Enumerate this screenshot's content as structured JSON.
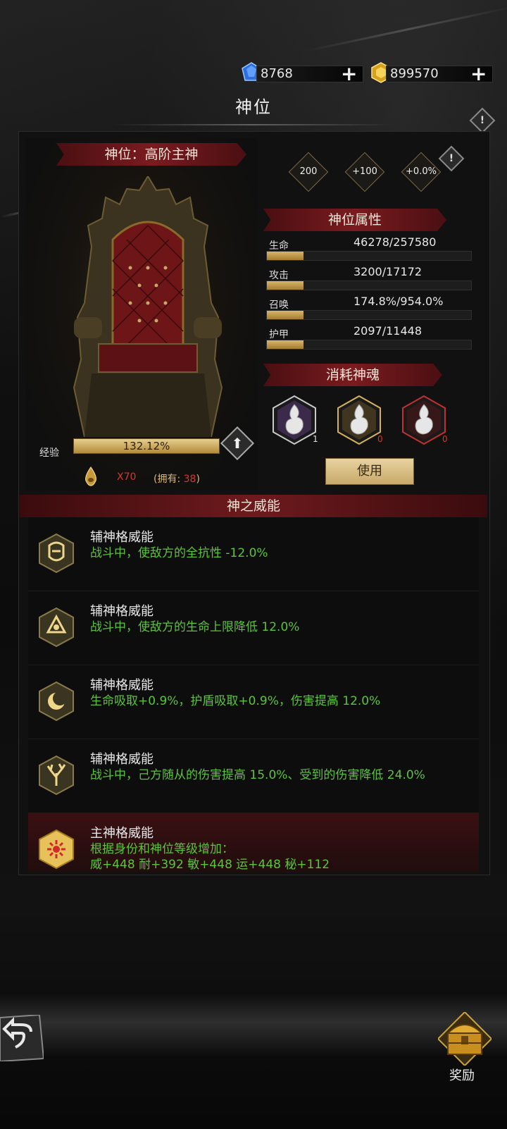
{
  "currency": {
    "gems": {
      "value": "8768",
      "icon": "blue-gem-icon",
      "add": "+"
    },
    "gold": {
      "value": "899570",
      "icon": "gold-gem-icon",
      "add": "+"
    }
  },
  "title": "神位",
  "info_icon": "!",
  "rank": {
    "label": "神位：高阶主神"
  },
  "exp": {
    "label": "经验",
    "percent_text": "132.12%",
    "percent": 132.12,
    "upgrade_icon": "up-arrow-icon"
  },
  "cost": {
    "amount": "X70",
    "own_prefix": "(拥有: ",
    "own_count": "38",
    "own_suffix": ")"
  },
  "bonus_diamonds": [
    "200",
    "+100",
    "+0.0%"
  ],
  "attributes": {
    "header": "神位属性",
    "items": [
      {
        "label": "生命",
        "value": "46278/257580",
        "fill": 0.18
      },
      {
        "label": "攻击",
        "value": "3200/17172",
        "fill": 0.18
      },
      {
        "label": "召唤",
        "value": "174.8%/954.0%",
        "fill": 0.18
      },
      {
        "label": "护甲",
        "value": "2097/11448",
        "fill": 0.18
      }
    ]
  },
  "souls": {
    "header": "消耗神魂",
    "items": [
      {
        "count": "1",
        "frame": "#c9c9c9",
        "accent": "#7a4aa6",
        "count_color": "#e0e0e0"
      },
      {
        "count": "0",
        "frame": "#d4b25a",
        "accent": "#8a6a2a",
        "count_color": "#d03a2c"
      },
      {
        "count": "0",
        "frame": "#c2302f",
        "accent": "#6e1616",
        "count_color": "#d03a2c"
      }
    ],
    "use_button": "使用"
  },
  "powers": {
    "header": "神之威能",
    "items": [
      {
        "title": "辅神格威能",
        "desc": "战斗中，使敌方的全抗性 -12.0%",
        "icon": "shield-mask-icon",
        "main": false
      },
      {
        "title": "辅神格威能",
        "desc": "战斗中，使敌方的生命上限降低 12.0%",
        "icon": "triangle-knot-icon",
        "main": false
      },
      {
        "title": "辅神格威能",
        "desc": "生命吸取+0.9%，护盾吸取+0.9%，伤害提高 12.0%",
        "icon": "crescent-moon-icon",
        "main": false
      },
      {
        "title": "辅神格威能",
        "desc": "战斗中，己方随从的伤害提高 15.0%、受到的伤害降低 24.0%",
        "icon": "tree-icon",
        "main": false
      },
      {
        "title": "主神格威能",
        "desc": "根据身份和神位等级增加：\n威+448  耐+392  敏+448  运+448  秘+112",
        "icon": "sun-flower-icon",
        "main": true
      }
    ]
  },
  "bottom": {
    "back_icon": "back-arrow-icon",
    "reward_label": "奖励",
    "reward_icon": "treasure-chest-icon"
  },
  "colors": {
    "accent_gold": "#d4b25a",
    "ribbon_red": "#7a1b1f",
    "desc_green": "#5bc43a",
    "cost_red": "#d03a2c"
  }
}
